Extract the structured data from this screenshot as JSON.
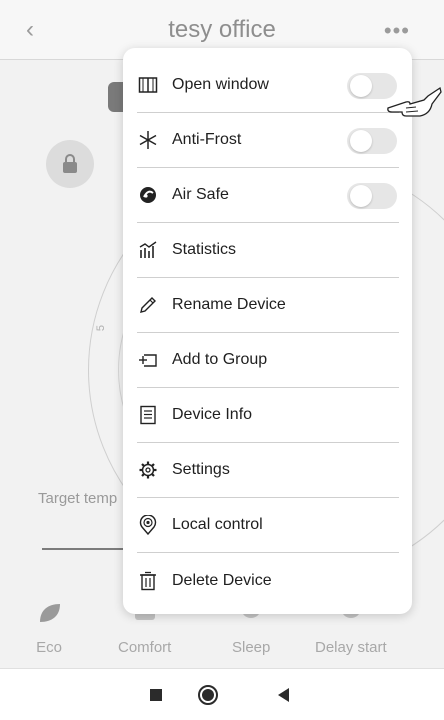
{
  "header": {
    "title": "tesy office",
    "back_icon": "chevron-left-icon",
    "more_icon": "more-horizontal-icon"
  },
  "background": {
    "target_label": "Target temp",
    "dial_tick": "5"
  },
  "modes": [
    {
      "label": "Eco",
      "icon": "leaf-icon"
    },
    {
      "label": "Comfort",
      "icon": "sofa-icon"
    },
    {
      "label": "Sleep",
      "icon": "moon-icon"
    },
    {
      "label": "Delay start",
      "icon": "timer-icon"
    }
  ],
  "menu": {
    "items": [
      {
        "label": "Open window",
        "icon": "window-icon",
        "toggle": false
      },
      {
        "label": "Anti-Frost",
        "icon": "snowflake-icon",
        "toggle": false
      },
      {
        "label": "Air Safe",
        "icon": "air-safe-icon",
        "toggle": false
      },
      {
        "label": "Statistics",
        "icon": "statistics-icon"
      },
      {
        "label": "Rename Device",
        "icon": "pencil-icon"
      },
      {
        "label": "Add to Group",
        "icon": "add-to-group-icon"
      },
      {
        "label": "Device Info",
        "icon": "document-icon"
      },
      {
        "label": "Settings",
        "icon": "gear-icon"
      },
      {
        "label": "Local control",
        "icon": "local-control-icon"
      },
      {
        "label": "Delete Device",
        "icon": "trash-icon"
      }
    ]
  },
  "navbar": {
    "icons": [
      "recent-apps-icon",
      "home-icon",
      "back-icon"
    ]
  },
  "colors": {
    "toggle_off": "#e6e6e6",
    "divider": "#cfcfcf",
    "dim_text": "#a8a8a8"
  }
}
